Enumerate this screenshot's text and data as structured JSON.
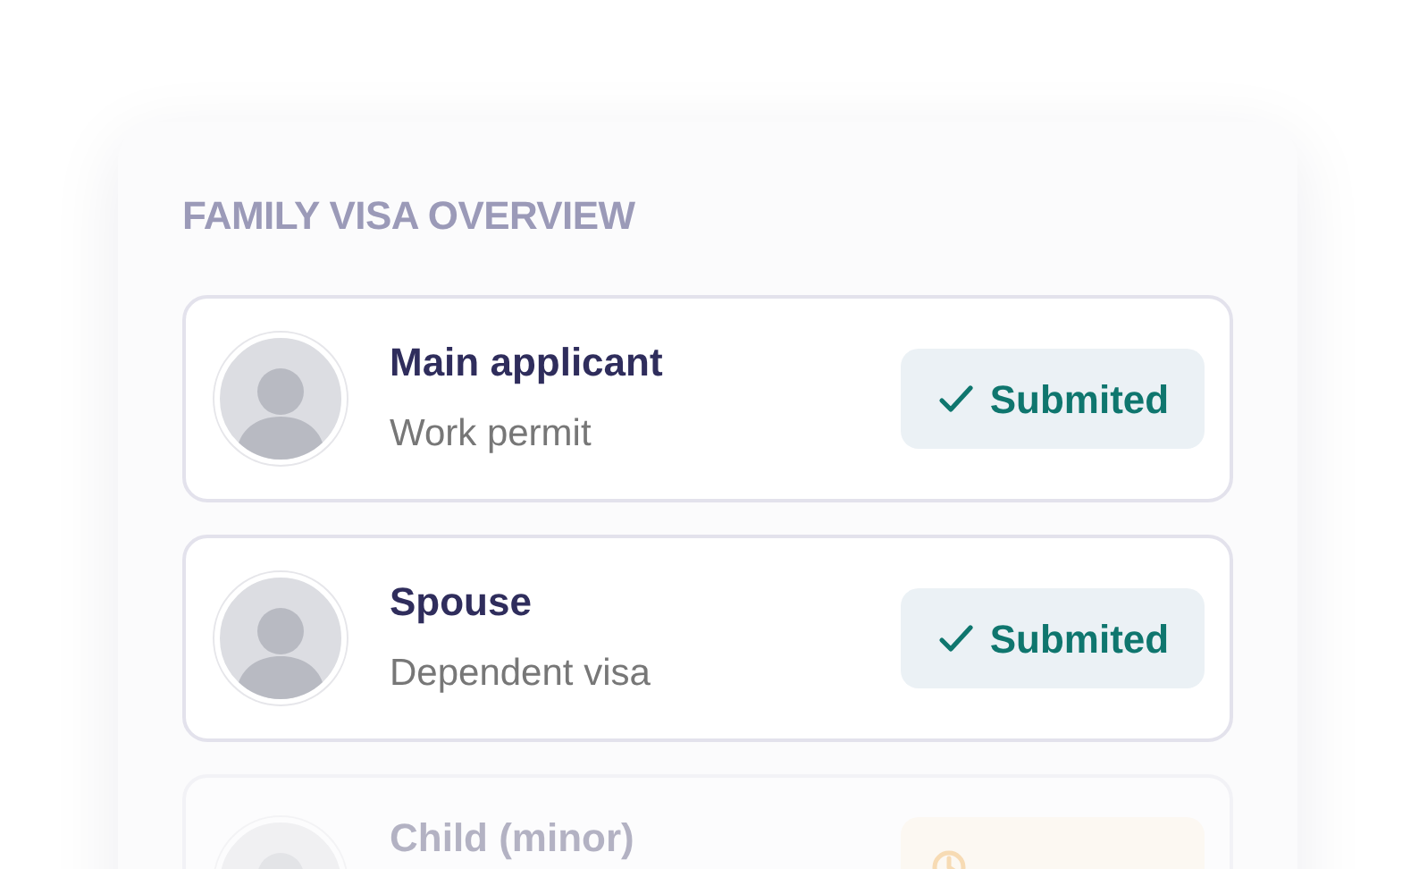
{
  "panel": {
    "title": "FAMILY VISA OVERVIEW"
  },
  "applicants": [
    {
      "name": "Main applicant",
      "visa": "Work permit",
      "faded": false,
      "status": {
        "kind": "submitted",
        "label": "Submited"
      }
    },
    {
      "name": "Spouse",
      "visa": "Dependent visa",
      "faded": false,
      "status": {
        "kind": "submitted",
        "label": "Submited"
      }
    },
    {
      "name": "Child (minor)",
      "faded": true,
      "status": {
        "kind": "pending"
      }
    }
  ]
}
